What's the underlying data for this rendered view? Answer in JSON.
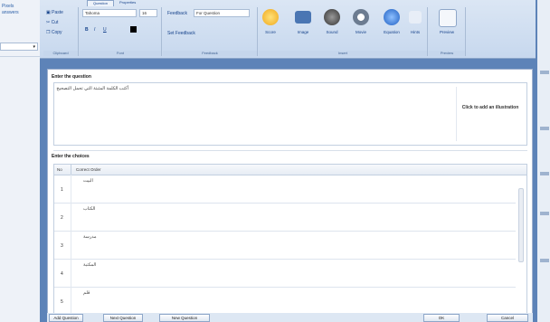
{
  "left_panel": {
    "nav_text": "Pixels\nanswers",
    "combo_arrow": "▾"
  },
  "ribbon": {
    "tabs": [
      "Question",
      "Properties"
    ],
    "clipboard": {
      "label": "Clipboard",
      "paste": "Paste",
      "cut": "Cut",
      "copy": "Copy"
    },
    "font": {
      "label": "Font",
      "family": "Tahoma",
      "size": "16",
      "bold": "B",
      "italic": "I",
      "underline": "U"
    },
    "feedback": {
      "label": "Feedback",
      "feedback_for": "Feedback",
      "feedback_value": "For Question",
      "set_feedback": "Set Feedback"
    },
    "insert": {
      "label": "Insert",
      "items": [
        "Score",
        "Image",
        "Sound",
        "Movie",
        "Equation",
        "Hints"
      ]
    },
    "preview": {
      "label": "Preview",
      "item": "Preview"
    }
  },
  "dialog": {
    "question_label": "Enter the question",
    "question_text": "أكتب الكلمة المثبتة التي تحمل التصحيح",
    "illustration_text": "Click to add an illustration",
    "choices_label": "Enter the choices",
    "grid_headers": [
      "No",
      "Correct Order"
    ],
    "rows": [
      {
        "num": "1",
        "text": "البيت"
      },
      {
        "num": "2",
        "text": "الكتاب"
      },
      {
        "num": "3",
        "text": "مدرسة"
      },
      {
        "num": "4",
        "text": "المكتبة"
      },
      {
        "num": "5",
        "text": "قلم"
      }
    ]
  },
  "buttons": {
    "add": "Add Question",
    "next": "Next Question",
    "new": "New Question",
    "ok": "OK",
    "cancel": "Cancel"
  }
}
